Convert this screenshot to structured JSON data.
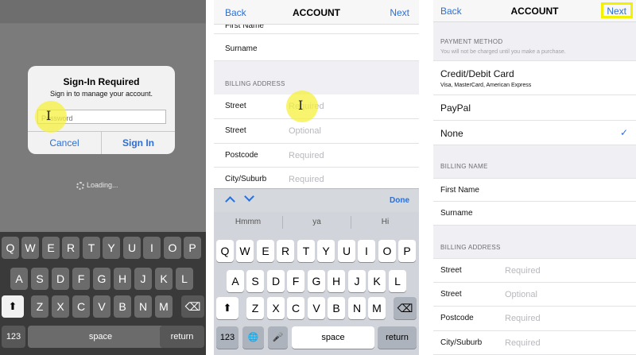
{
  "panel1": {
    "alert": {
      "title": "Sign-In Required",
      "message": "Sign in to manage your account.",
      "field_placeholder": "Password",
      "cancel": "Cancel",
      "signin": "Sign In"
    },
    "loading": "Loading...",
    "keyboard": {
      "row1": [
        "Q",
        "W",
        "E",
        "R",
        "T",
        "Y",
        "U",
        "I",
        "O",
        "P"
      ],
      "row2": [
        "A",
        "S",
        "D",
        "F",
        "G",
        "H",
        "J",
        "K",
        "L"
      ],
      "row3": [
        "Z",
        "X",
        "C",
        "V",
        "B",
        "N",
        "M"
      ],
      "shift": "⬆",
      "backspace": "⌫",
      "numbers": "123",
      "space": "space",
      "return": "return"
    }
  },
  "panel2": {
    "nav": {
      "back": "Back",
      "title": "ACCOUNT",
      "next": "Next"
    },
    "first_name": "First Name",
    "surname": "Surname",
    "billing_address_header": "BILLING ADDRESS",
    "rows": [
      {
        "label": "Street",
        "value": "Required"
      },
      {
        "label": "Street",
        "value": "Optional"
      },
      {
        "label": "Postcode",
        "value": "Required"
      },
      {
        "label": "City/Suburb",
        "value": "Required"
      }
    ],
    "toolbar": {
      "done": "Done"
    },
    "suggestions": [
      "Hmmm",
      "ya",
      "Hi"
    ],
    "keyboard": {
      "row1": [
        "Q",
        "W",
        "E",
        "R",
        "T",
        "Y",
        "U",
        "I",
        "O",
        "P"
      ],
      "row2": [
        "A",
        "S",
        "D",
        "F",
        "G",
        "H",
        "J",
        "K",
        "L"
      ],
      "row3": [
        "Z",
        "X",
        "C",
        "V",
        "B",
        "N",
        "M"
      ],
      "shift": "⬆",
      "backspace": "⌫",
      "numbers": "123",
      "globe": "🌐",
      "mic": "🎤",
      "space": "space",
      "return": "return"
    }
  },
  "panel3": {
    "nav": {
      "back": "Back",
      "title": "ACCOUNT",
      "next": "Next"
    },
    "payment_header": "PAYMENT METHOD",
    "payment_note": "You will not be charged until you make a purchase.",
    "credit_title": "Credit/Debit Card",
    "credit_sub": "Visa, MasterCard, American Express",
    "paypal": "PayPal",
    "none": "None",
    "checkmark": "✓",
    "billing_name_header": "BILLING NAME",
    "first_name": "First Name",
    "surname": "Surname",
    "billing_address_header": "BILLING ADDRESS",
    "rows": [
      {
        "label": "Street",
        "value": "Required"
      },
      {
        "label": "Street",
        "value": "Optional"
      },
      {
        "label": "Postcode",
        "value": "Required"
      },
      {
        "label": "City/Suburb",
        "value": "Required"
      }
    ]
  },
  "colors": {
    "accent": "#2d6fd6",
    "highlight": "#f2f200"
  }
}
